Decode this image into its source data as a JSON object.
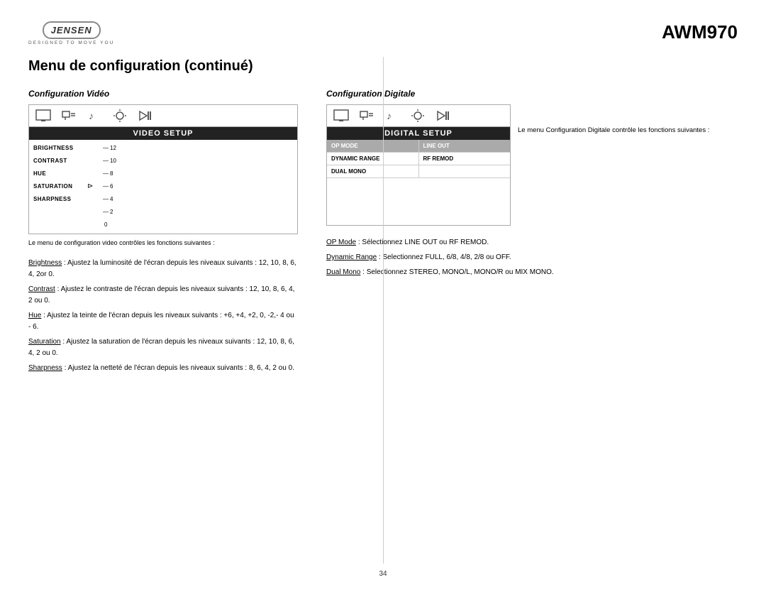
{
  "header": {
    "logo": "JENSEN",
    "tagline": "DESIGNED TO MOVE YOU",
    "model": "AWM970"
  },
  "page": {
    "title": "Menu de configuration (continué)",
    "number": "34"
  },
  "left_section": {
    "title": "Configuration Vidéo",
    "icons": [
      "■",
      "🖥",
      "♪",
      "◑",
      "▶|"
    ],
    "setup_label": "VIDEO SETUP",
    "menu_desc": "Le menu de configuration video contrôles les fonctions suivantes :",
    "rows": [
      {
        "label": "BRIGHTNESS",
        "has_arrow": false,
        "value": "12"
      },
      {
        "label": "CONTRAST",
        "has_arrow": false,
        "value": "10"
      },
      {
        "label": "HUE",
        "has_arrow": false,
        "value": "8"
      },
      {
        "label": "SATURATION",
        "has_arrow": true,
        "value": "6"
      },
      {
        "label": "SHARPNESS",
        "has_arrow": false,
        "value": "4"
      }
    ],
    "scale_values": [
      "12",
      "10",
      "8",
      "6",
      "4",
      "2",
      "0"
    ],
    "descriptions": [
      {
        "term": "Brightness",
        "text": ": Ajustez la luminosité de l'écran depuis les niveaux suivants : 12, 10, 8, 6, 4, 2or 0."
      },
      {
        "term": "Contrast",
        "text": ": Ajustez le contraste de l'écran depuis les niveaux suivants : 12, 10, 8, 6, 4, 2 ou 0."
      },
      {
        "term": "Hue",
        "text": ": Ajustez la teinte de l'écran depuis les niveaux suivants : +6, +4, +2, 0, -2,- 4 ou - 6."
      },
      {
        "term": "Saturation",
        "text": ": Ajustez la saturation de l'écran depuis les niveaux suivants : 12, 10, 8, 6, 4, 2 ou 0."
      },
      {
        "term": "Sharpness",
        "text": ": Ajustez la netteté de l'écran depuis les niveaux suivants : 8, 6, 4, 2 ou 0."
      }
    ]
  },
  "right_section": {
    "title": "Configuration Digitale",
    "icons": [
      "■",
      "🖥",
      "♪",
      "◑",
      "▶|"
    ],
    "setup_label": "DIGITAL SETUP",
    "menu_desc": "Le menu Configuration Digitale contrôle les fonctions suivantes :",
    "table": {
      "row1": [
        "OP MODE",
        "LINE OUT"
      ],
      "row2": [
        "DYNAMIC RANGE",
        "RF REMOD"
      ],
      "row3": [
        "DUAL MONO",
        ""
      ]
    },
    "descriptions": [
      {
        "term": "OP Mode",
        "text": " : Sélectionnez LINE OUT ou RF REMOD."
      },
      {
        "term": "Dynamic Range",
        "text": " : Selectionnez FULL, 6/8, 4/8, 2/8 ou OFF."
      },
      {
        "term": "Dual Mono",
        "text": " : Selectionnez STEREO, MONO/L, MONO/R ou MIX MONO."
      }
    ]
  }
}
